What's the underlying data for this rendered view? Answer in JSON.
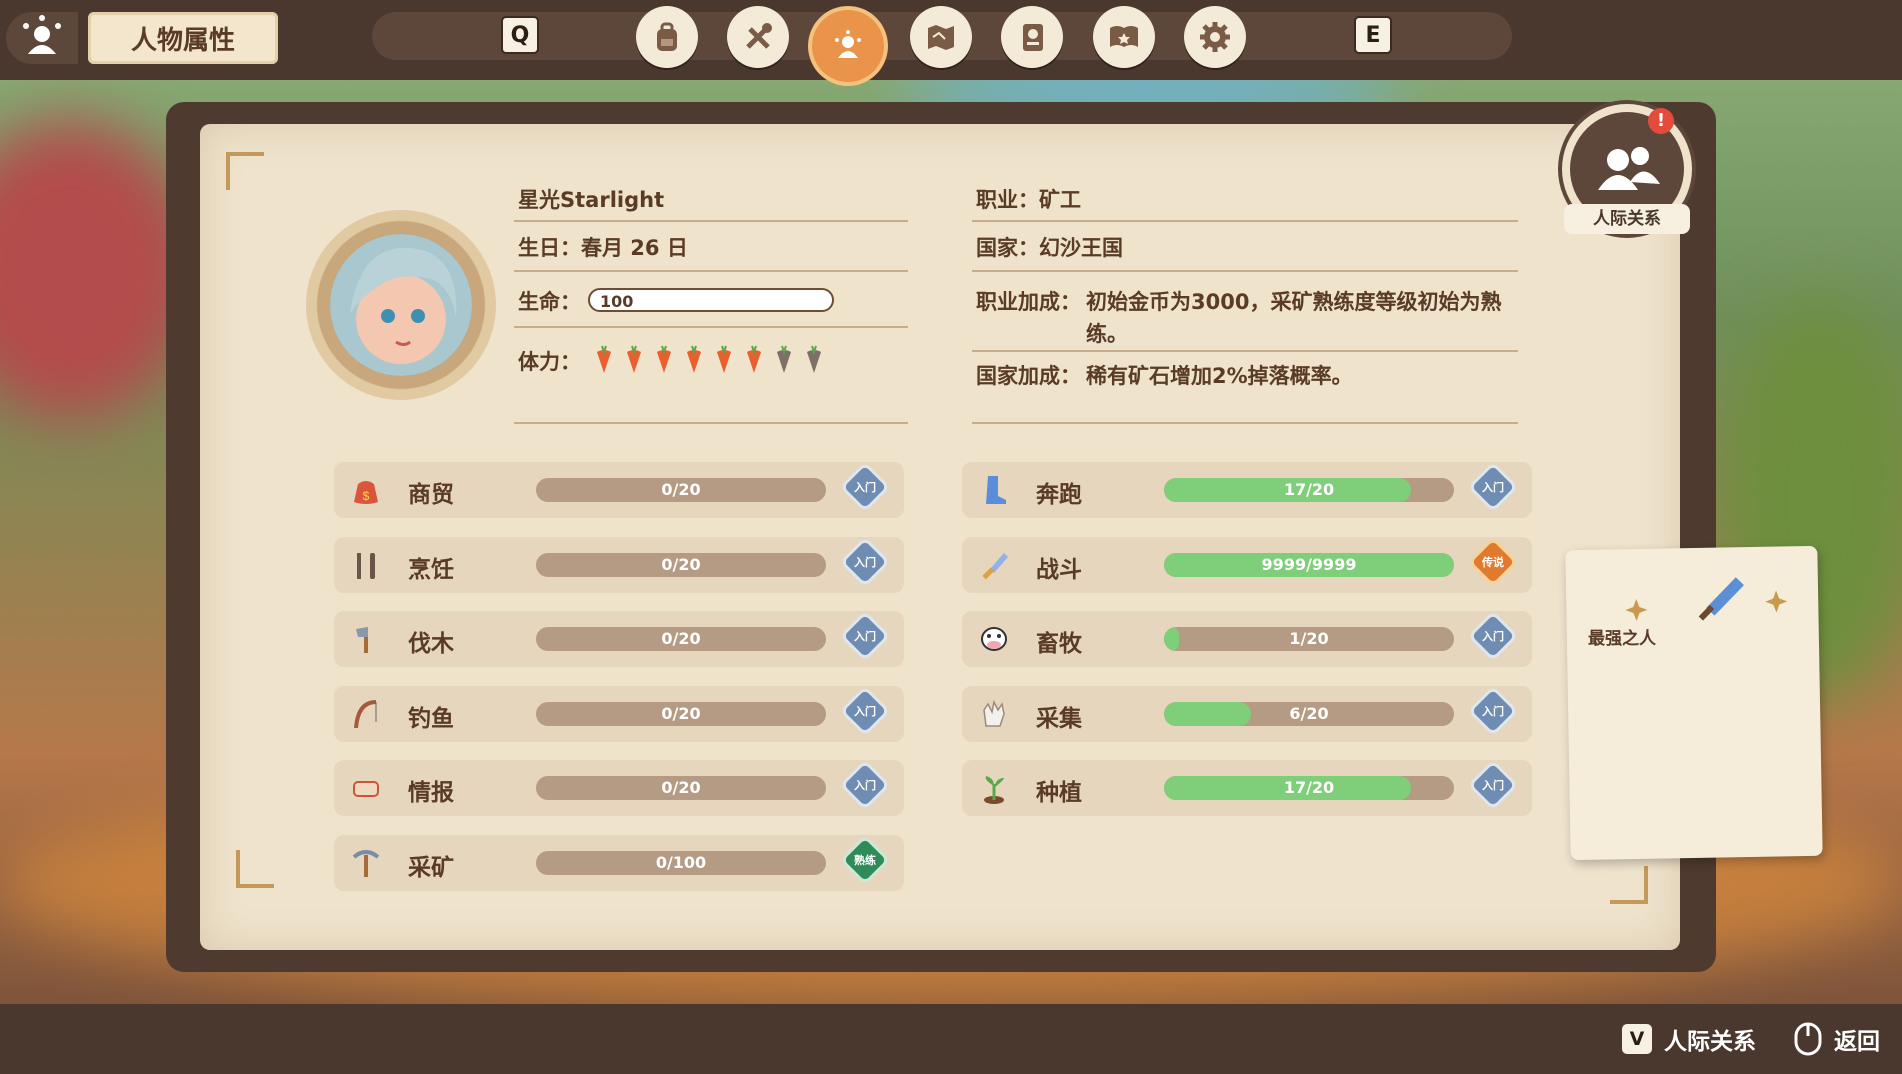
{
  "header": {
    "title": "人物属性",
    "key_left": "Q",
    "key_right": "E",
    "tabs": [
      {
        "icon": "backpack-icon"
      },
      {
        "icon": "tools-icon"
      },
      {
        "icon": "character-icon",
        "active": true
      },
      {
        "icon": "map-icon"
      },
      {
        "icon": "journal-icon"
      },
      {
        "icon": "book-icon"
      },
      {
        "icon": "settings-icon"
      }
    ]
  },
  "profile": {
    "name": "星光Starlight",
    "birthday": "生日：春月 26 日",
    "hp_label": "生命：",
    "hp_value": "100",
    "stamina_label": "体力：",
    "stamina_full": 6,
    "stamina_total": 8,
    "job": "职业：矿工",
    "country": "国家：幻沙王国",
    "job_bonus_label": "职业加成：",
    "job_bonus": "初始金币为3000，采矿熟练度等级初始为熟练。",
    "country_bonus_label": "国家加成：",
    "country_bonus": "稀有矿石增加2%掉落概率。"
  },
  "skills_left": [
    {
      "name": "商贸",
      "value": "0/20",
      "fraction": 0,
      "badge": "入门",
      "icon": "money-bag-icon"
    },
    {
      "name": "烹饪",
      "value": "0/20",
      "fraction": 0,
      "badge": "入门",
      "icon": "fork-knife-icon"
    },
    {
      "name": "伐木",
      "value": "0/20",
      "fraction": 0,
      "badge": "入门",
      "icon": "axe-icon"
    },
    {
      "name": "钓鱼",
      "value": "0/20",
      "fraction": 0,
      "badge": "入门",
      "icon": "fishing-rod-icon"
    },
    {
      "name": "情报",
      "value": "0/20",
      "fraction": 0,
      "badge": "入门",
      "icon": "scroll-icon"
    },
    {
      "name": "采矿",
      "value": "0/100",
      "fraction": 0,
      "badge": "熟练",
      "icon": "pickaxe-icon"
    }
  ],
  "skills_right": [
    {
      "name": "奔跑",
      "value": "17/20",
      "fraction": 0.85,
      "badge": "入门",
      "icon": "boot-icon"
    },
    {
      "name": "战斗",
      "value": "9999/9999",
      "fraction": 1.0,
      "badge": "传说",
      "icon": "sword-icon"
    },
    {
      "name": "畜牧",
      "value": "1/20",
      "fraction": 0.05,
      "badge": "入门",
      "icon": "cow-icon"
    },
    {
      "name": "采集",
      "value": "6/20",
      "fraction": 0.3,
      "badge": "入门",
      "icon": "glove-icon"
    },
    {
      "name": "种植",
      "value": "17/20",
      "fraction": 0.85,
      "badge": "入门",
      "icon": "sprout-icon"
    }
  ],
  "relationship": {
    "label": "人际关系",
    "alert": "!"
  },
  "title_note": {
    "title": "最强之人"
  },
  "footer": {
    "rel_key": "V",
    "rel_label": "人际关系",
    "back_label": "返回"
  },
  "colors": {
    "bar_fill": "#7fcf7a",
    "bar_empty": "#b59a84",
    "badge_beginner": "#6f8cb3",
    "badge_legend": "#e07a2f",
    "badge_skilled": "#2f8c5a",
    "active_tab": "#e9944a"
  }
}
